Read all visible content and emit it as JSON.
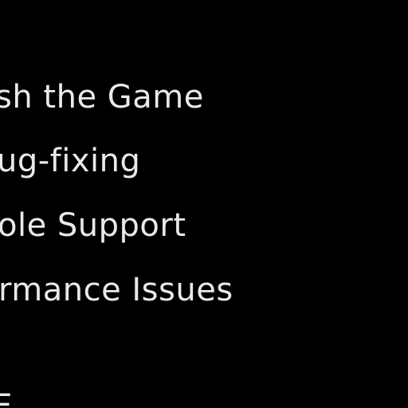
{
  "list": {
    "items": [
      {
        "label": "sh the Game"
      },
      {
        "label": "ug-fixing"
      },
      {
        "label": "ole Support"
      },
      {
        "label": "rmance Issues"
      },
      {
        "label": "F   "
      }
    ]
  }
}
